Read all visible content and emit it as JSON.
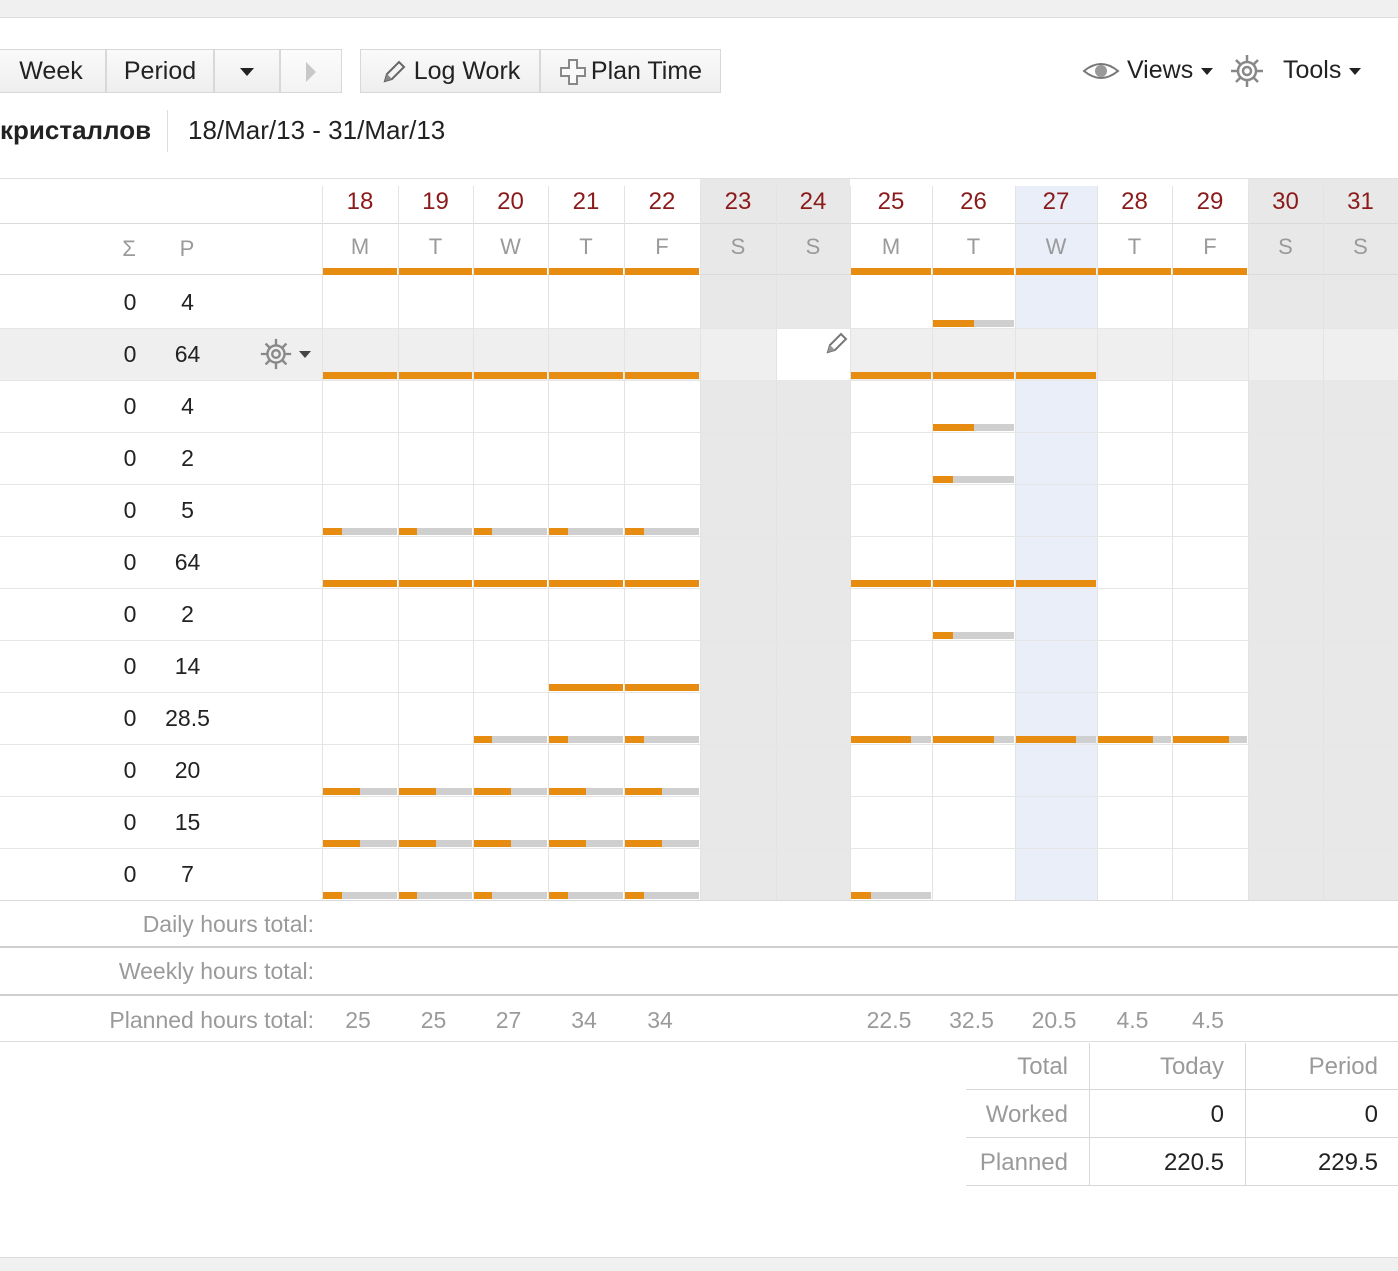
{
  "toolbar": {
    "week_label": "Week",
    "period_label": "Period",
    "log_work_label": "Log Work",
    "plan_time_label": "Plan Time",
    "views_label": "Views",
    "tools_label": "Tools"
  },
  "project": {
    "name": "кристаллов",
    "range": "18/Mar/13 - 31/Mar/13"
  },
  "grid": {
    "sigma_header": "Σ",
    "p_header": "P",
    "days": [
      {
        "num": "18",
        "dow": "M",
        "type": "weekday"
      },
      {
        "num": "19",
        "dow": "T",
        "type": "weekday"
      },
      {
        "num": "20",
        "dow": "W",
        "type": "weekday"
      },
      {
        "num": "21",
        "dow": "T",
        "type": "weekday"
      },
      {
        "num": "22",
        "dow": "F",
        "type": "weekday"
      },
      {
        "num": "23",
        "dow": "S",
        "type": "weekend"
      },
      {
        "num": "24",
        "dow": "S",
        "type": "weekend"
      },
      {
        "num": "25",
        "dow": "M",
        "type": "weekday"
      },
      {
        "num": "26",
        "dow": "T",
        "type": "weekday"
      },
      {
        "num": "27",
        "dow": "W",
        "type": "today"
      },
      {
        "num": "28",
        "dow": "T",
        "type": "weekday"
      },
      {
        "num": "29",
        "dow": "F",
        "type": "weekday"
      },
      {
        "num": "30",
        "dow": "S",
        "type": "weekend"
      },
      {
        "num": "31",
        "dow": "S",
        "type": "weekend"
      }
    ],
    "rows": [
      {
        "sigma": "0",
        "p": "4"
      },
      {
        "sigma": "0",
        "p": "64"
      },
      {
        "sigma": "0",
        "p": "4"
      },
      {
        "sigma": "0",
        "p": "2"
      },
      {
        "sigma": "0",
        "p": "5"
      },
      {
        "sigma": "0",
        "p": "64"
      },
      {
        "sigma": "0",
        "p": "2"
      },
      {
        "sigma": "0",
        "p": "14"
      },
      {
        "sigma": "0",
        "p": "28.5"
      },
      {
        "sigma": "0",
        "p": "20"
      },
      {
        "sigma": "0",
        "p": "15"
      },
      {
        "sigma": "0",
        "p": "7"
      }
    ]
  },
  "footer": {
    "daily_label": "Daily hours total:",
    "weekly_label": "Weekly hours total:",
    "planned_label": "Planned hours total:",
    "planned_totals": [
      "25",
      "25",
      "27",
      "34",
      "34",
      "",
      "",
      "22.5",
      "32.5",
      "20.5",
      "4.5",
      "4.5",
      "",
      ""
    ]
  },
  "summary": {
    "headers": [
      "Total",
      "Today",
      "Period"
    ],
    "rows": [
      {
        "label": "Worked",
        "today": "0",
        "period": "0"
      },
      {
        "label": "Planned",
        "today": "220.5",
        "period": "229.5"
      }
    ]
  },
  "colors": {
    "accent_orange": "#e58c11",
    "track_gray": "#cfcfcf",
    "weekend_bg": "#e8e8e8",
    "today_bg": "#e9eef9",
    "date_red": "#8b1a1a",
    "muted_text": "#9a9a9a"
  }
}
